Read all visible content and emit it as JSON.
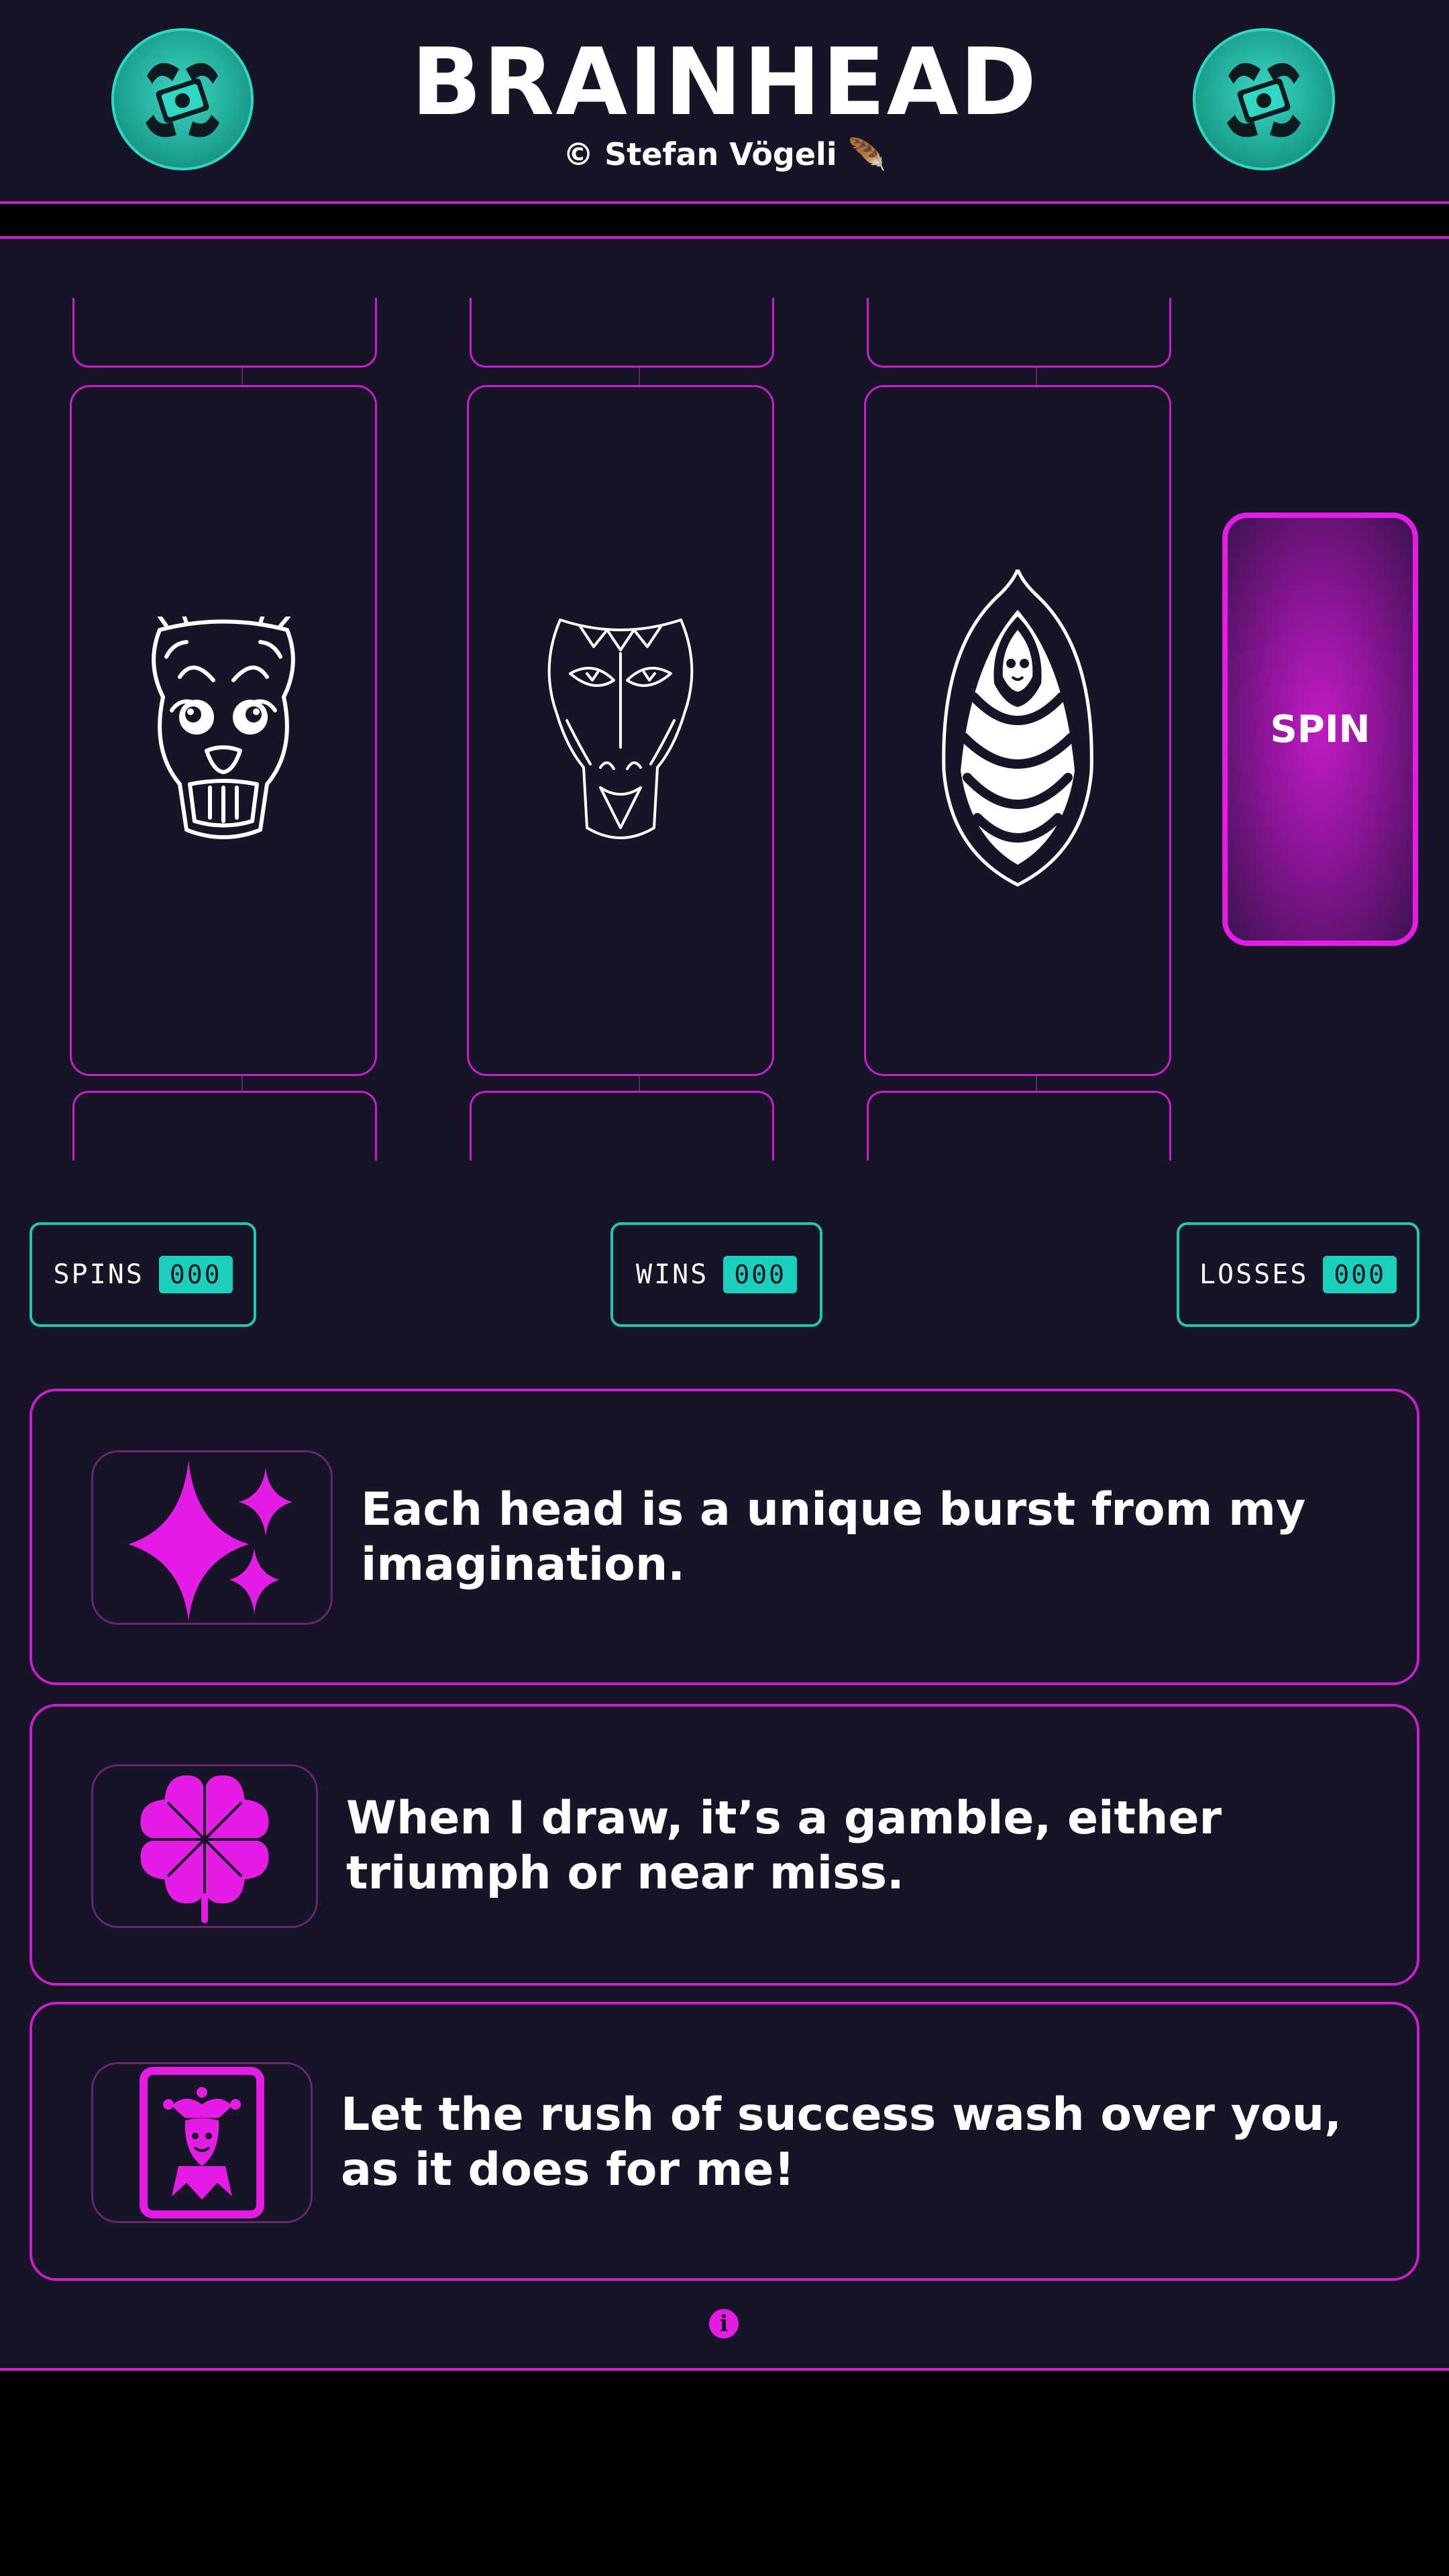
{
  "header": {
    "title": "BRAINHEAD",
    "subtitle": "© Stefan Vögeli 🪶"
  },
  "icons": {
    "coin": "money-wings-icon",
    "sparkles": "sparkles-icon",
    "clover": "four-leaf-clover-icon",
    "joker": "joker-card-icon",
    "info": "info-icon"
  },
  "reels": [
    {
      "symbol": "wide-eyed-head-drawing"
    },
    {
      "symbol": "owl-mask-head-drawing"
    },
    {
      "symbol": "striped-leaf-face-drawing"
    }
  ],
  "spin": {
    "label": "SPIN"
  },
  "counters": {
    "spins": {
      "label": "SPINS",
      "value": "000"
    },
    "wins": {
      "label": "WINS",
      "value": "000"
    },
    "losses": {
      "label": "LOSSES",
      "value": "000"
    }
  },
  "cards": [
    {
      "line1": "Each head is a unique burst from my",
      "line2": "imagination."
    },
    {
      "line1": "When I draw, it’s a gamble, either",
      "line2": "triumph or near miss."
    },
    {
      "line1": "Let the rush of success wash over you,",
      "line2": "as it does for me!"
    }
  ],
  "info": {
    "glyph": "i"
  },
  "colors": {
    "background": "#161527",
    "accent_magenta": "#e51ce5",
    "accent_teal": "#22c7b4"
  }
}
